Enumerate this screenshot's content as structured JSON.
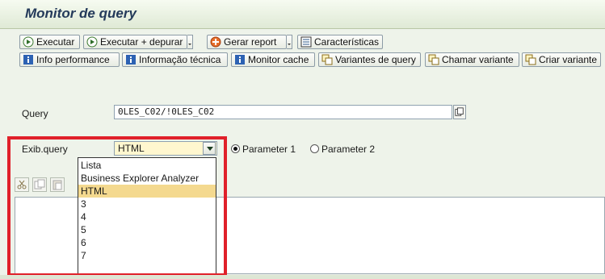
{
  "title": "Monitor de query",
  "toolbar": {
    "row1": [
      {
        "label": "Executar",
        "icon": "execute-icon"
      },
      {
        "label": "Executar + depurar",
        "icon": "execute-debug-icon"
      },
      {
        "label": "Gerar report",
        "icon": "generate-report-icon"
      },
      {
        "label": "Características",
        "icon": "characteristics-icon"
      }
    ],
    "row2": [
      {
        "label": "Info performance",
        "icon": "info-icon"
      },
      {
        "label": "Informação técnica",
        "icon": "info-icon"
      },
      {
        "label": "Monitor cache",
        "icon": "info-icon"
      },
      {
        "label": "Variantes de query",
        "icon": "variant-icon"
      },
      {
        "label": "Chamar variante",
        "icon": "variant-icon"
      },
      {
        "label": "Criar variante",
        "icon": "variant-icon"
      }
    ]
  },
  "query": {
    "label": "Query",
    "value": "0LES_C02/!0LES_C02"
  },
  "display": {
    "label": "Exib.query",
    "selected": "HTML",
    "options": [
      "Lista",
      "Business Explorer Analyzer",
      "HTML",
      "3",
      "4",
      "5",
      "6",
      "7"
    ],
    "highlighted_index": 2
  },
  "radios": [
    {
      "label": "Parameter 1",
      "checked": true
    },
    {
      "label": "Parameter 2",
      "checked": false
    }
  ],
  "colors": {
    "accent_red": "#e0202a",
    "highlight": "#f4d98f",
    "title": "#243a5a"
  }
}
